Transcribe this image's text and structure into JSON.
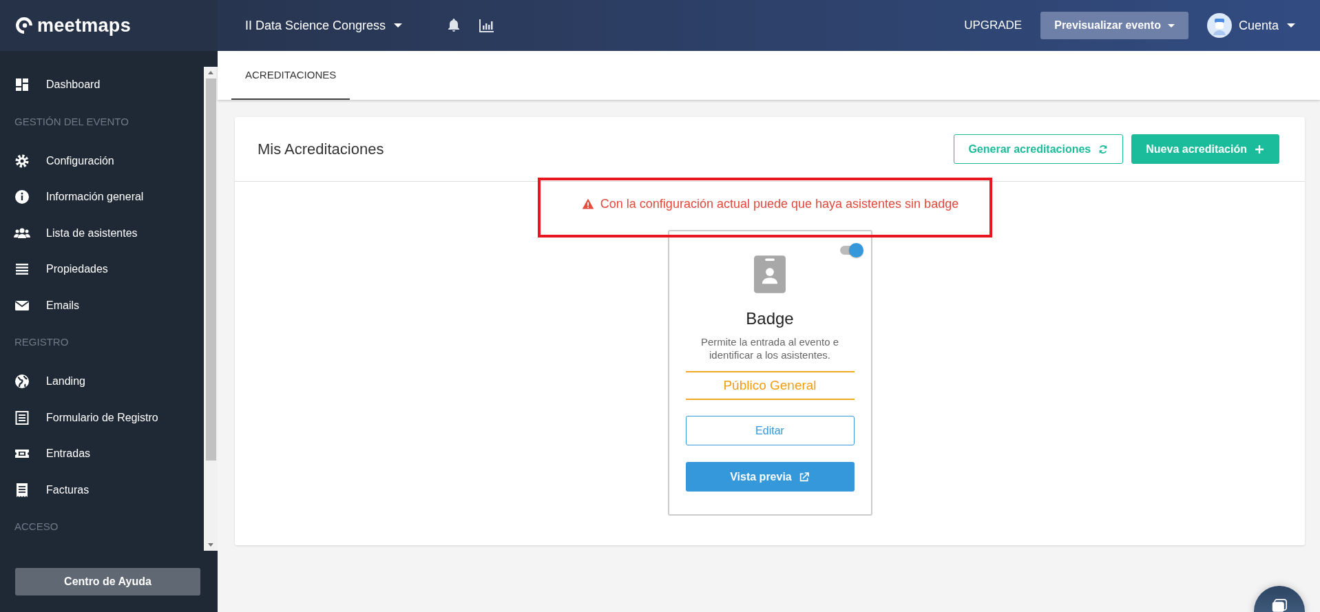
{
  "brand": {
    "name": "meetmaps"
  },
  "topbar": {
    "event": "II Data Science Congress",
    "upgrade": "UPGRADE",
    "preview_button": "Previsualizar evento",
    "account": "Cuenta"
  },
  "sidebar": {
    "sections": [
      {
        "items": [
          {
            "label": "Dashboard"
          }
        ]
      },
      {
        "title": "GESTIÓN DEL EVENTO",
        "items": [
          {
            "label": "Configuración"
          },
          {
            "label": "Información general"
          },
          {
            "label": "Lista de asistentes"
          },
          {
            "label": "Propiedades"
          },
          {
            "label": "Emails"
          }
        ]
      },
      {
        "title": "REGISTRO",
        "items": [
          {
            "label": "Landing"
          },
          {
            "label": "Formulario de Registro"
          },
          {
            "label": "Entradas"
          },
          {
            "label": "Facturas"
          }
        ]
      },
      {
        "title": "ACCESO"
      }
    ],
    "help_button": "Centro de Ayuda"
  },
  "tabs": [
    {
      "label": "ACREDITACIONES",
      "selected": true
    }
  ],
  "panel": {
    "title": "Mis Acreditaciones",
    "buttons": [
      {
        "label": "Generar acreditaciones",
        "kind": "outline"
      },
      {
        "label": "Nueva acreditación",
        "kind": "primary"
      }
    ],
    "warning": "Con la configuración actual puede que haya asistentes sin badge",
    "credentials": [
      {
        "title": "Badge",
        "enabled": true,
        "description": "Permite la entrada al evento e identificar a los asistentes.",
        "audience": "Público General",
        "edit_button": "Editar",
        "preview_button": "Vista previa"
      }
    ]
  }
}
